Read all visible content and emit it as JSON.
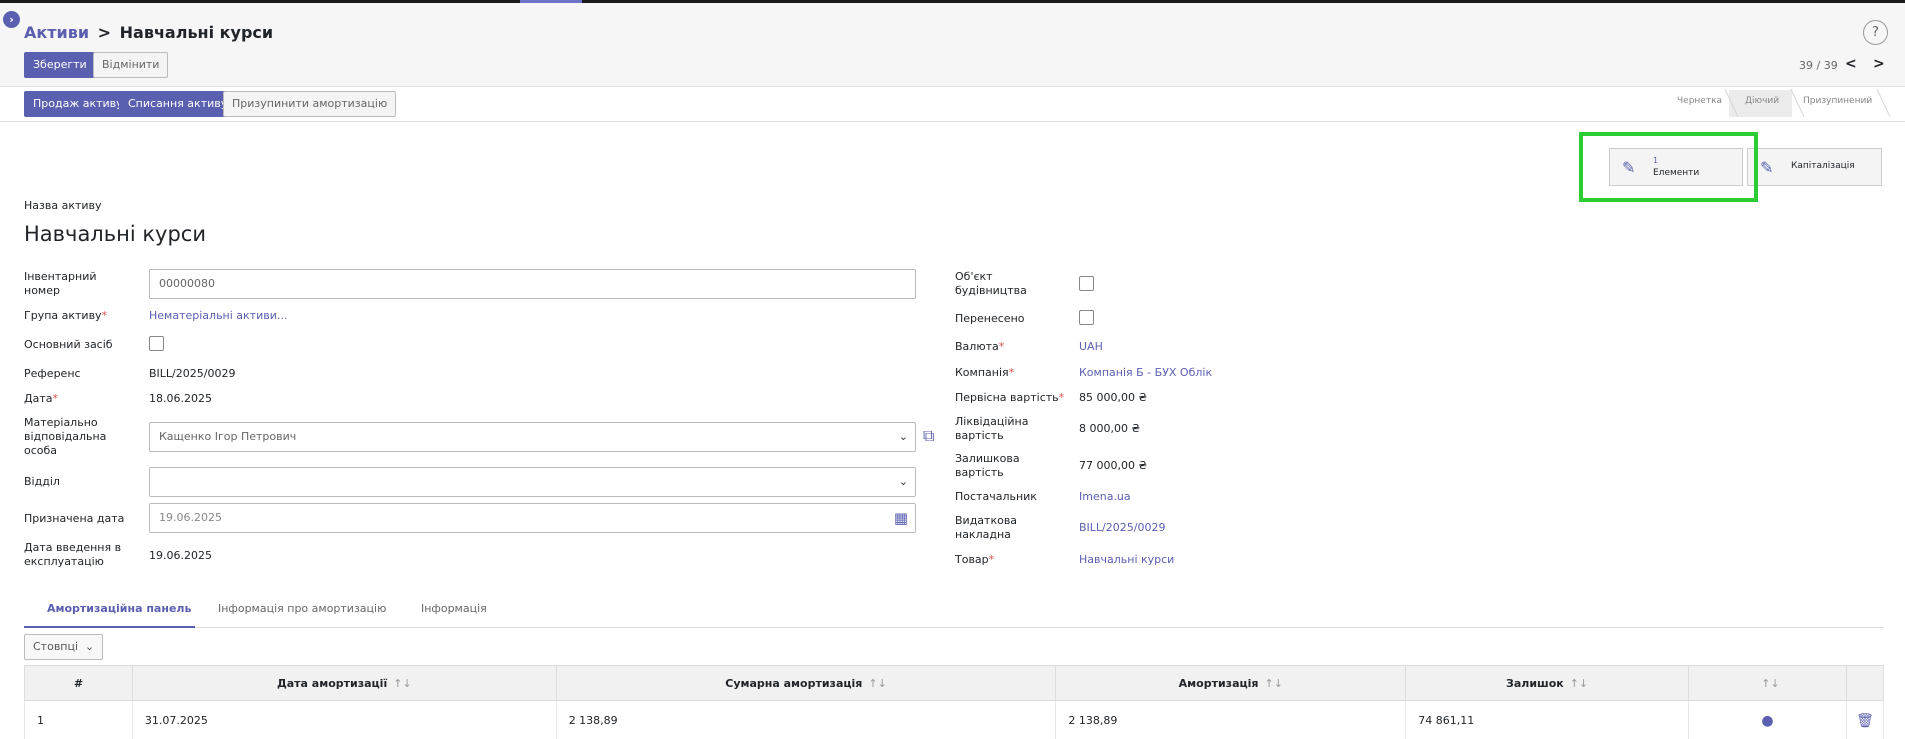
{
  "breadcrumb": {
    "parent": "Активи",
    "separator": ">",
    "current": "Навчальні курси"
  },
  "toolbar": {
    "save_label": "Зберегти",
    "discard_label": "Відмінити"
  },
  "pager": {
    "text": "39 / 39",
    "prev": "<",
    "next": ">"
  },
  "help": "?",
  "actions": {
    "sell": "Продаж активу",
    "dispose": "Списання активу",
    "pause": "Призупинити амортизацію"
  },
  "statusbar": {
    "draft": "Чернетка",
    "running": "Діючий",
    "paused": "Призупинений"
  },
  "smart_buttons": {
    "elements_count": "1",
    "elements_label": "Елементи",
    "capitalization_label": "Капіталізація"
  },
  "form": {
    "name_label": "Назва активу",
    "name_value": "Навчальні курси",
    "left": {
      "inventory_label": "Інвентарний номер",
      "inventory_value": "00000080",
      "group_label": "Група активу",
      "group_value": "Нематеріальні активи...",
      "fixed_asset_label": "Основний засіб",
      "reference_label": "Референс",
      "reference_value": "BILL/2025/0029",
      "date_label": "Дата",
      "date_value": "18.06.2025",
      "responsible_label": "Матеріально відповідальна особа",
      "responsible_value": "Кащенко Ігор Петрович",
      "department_label": "Відділ",
      "department_value": "",
      "assigned_date_label": "Призначена дата",
      "assigned_date_value": "19.06.2025",
      "commission_date_label": "Дата введення в експлуатацію",
      "commission_date_value": "19.06.2025"
    },
    "right": {
      "construction_label": "Об'єкт будівництва",
      "transferred_label": "Перенесено",
      "currency_label": "Валюта",
      "currency_value": "UAH",
      "company_label": "Компанія",
      "company_value": "Компанія Б - БУХ Облік",
      "original_value_label": "Первісна вартість",
      "original_value": "85 000,00 ₴",
      "salvage_label": "Ліквідаційна вартість",
      "salvage_value": "8 000,00 ₴",
      "residual_label": "Залишкова вартість",
      "residual_value": "77 000,00 ₴",
      "vendor_label": "Постачальник",
      "vendor_value": "Imena.ua",
      "bill_label": "Видаткова накладна",
      "bill_value": "BILL/2025/0029",
      "product_label": "Товар",
      "product_value": "Навчальні курси"
    }
  },
  "tabs": [
    "Амортизаційна панель",
    "Інформація про амортизацію",
    "Інформація"
  ],
  "columns_button": "Стовпці",
  "table": {
    "headers": [
      "#",
      "Дата амортизації",
      "Сумарна амортизація",
      "Амортизація",
      "Залишок"
    ],
    "rows": [
      {
        "num": "1",
        "date": "31.07.2025",
        "cumulative": "2 138,89",
        "amount": "2 138,89",
        "remaining": "74 861,11"
      }
    ]
  },
  "colors": {
    "accent": "#5a5fb0",
    "highlight": "#2ccc33",
    "required": "#d9534f"
  }
}
